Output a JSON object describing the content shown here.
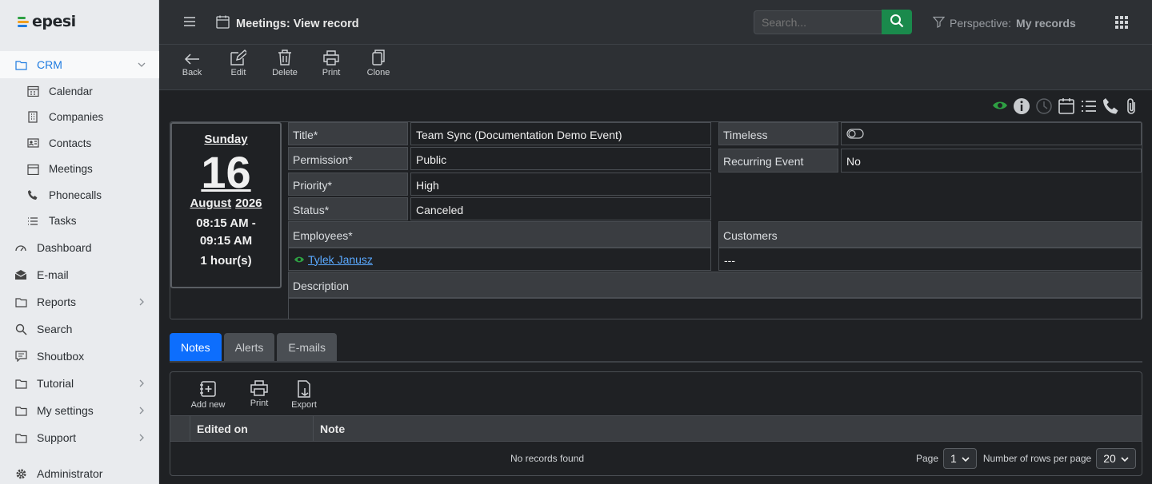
{
  "app": {
    "logo_text": "epesi"
  },
  "sidebar": {
    "crm": "CRM",
    "crm_children": [
      "Calendar",
      "Companies",
      "Contacts",
      "Meetings",
      "Phonecalls",
      "Tasks"
    ],
    "items": [
      "Dashboard",
      "E-mail",
      "Reports",
      "Search",
      "Shoutbox",
      "Tutorial",
      "My settings",
      "Support",
      "Administrator"
    ]
  },
  "topbar": {
    "title": "Meetings: View record",
    "search_placeholder": "Search...",
    "perspective_label": "Perspective:",
    "perspective_value": "My records"
  },
  "actions": [
    "Back",
    "Edit",
    "Delete",
    "Print",
    "Clone"
  ],
  "calendar": {
    "weekday": "Sunday",
    "day": "16",
    "month": "August",
    "year": "2026",
    "time_start": "08:15 AM -",
    "time_end": "09:15 AM",
    "duration": "1 hour(s)"
  },
  "record": {
    "title_label": "Title*",
    "title": "Team Sync (Documentation Demo Event)",
    "permission_label": "Permission*",
    "permission": "Public",
    "priority_label": "Priority*",
    "priority": "High",
    "status_label": "Status*",
    "status": "Canceled",
    "timeless_label": "Timeless",
    "recurring_label": "Recurring Event",
    "recurring": "No",
    "employees_label": "Employees*",
    "employee": "Tylek Janusz",
    "customers_label": "Customers",
    "customers": "---",
    "description_label": "Description"
  },
  "tabs": [
    "Notes",
    "Alerts",
    "E-mails"
  ],
  "notes": {
    "actions": [
      "Add new",
      "Print",
      "Export"
    ],
    "col_edited": "Edited on",
    "col_note": "Note",
    "empty": "No records found",
    "page_label": "Page",
    "page_value": "1",
    "rows_label": "Number of rows per page",
    "rows_value": "20"
  },
  "colors": {
    "accent": "#0d6efd",
    "success": "#1a8a4c",
    "link": "#5aa9ff"
  }
}
